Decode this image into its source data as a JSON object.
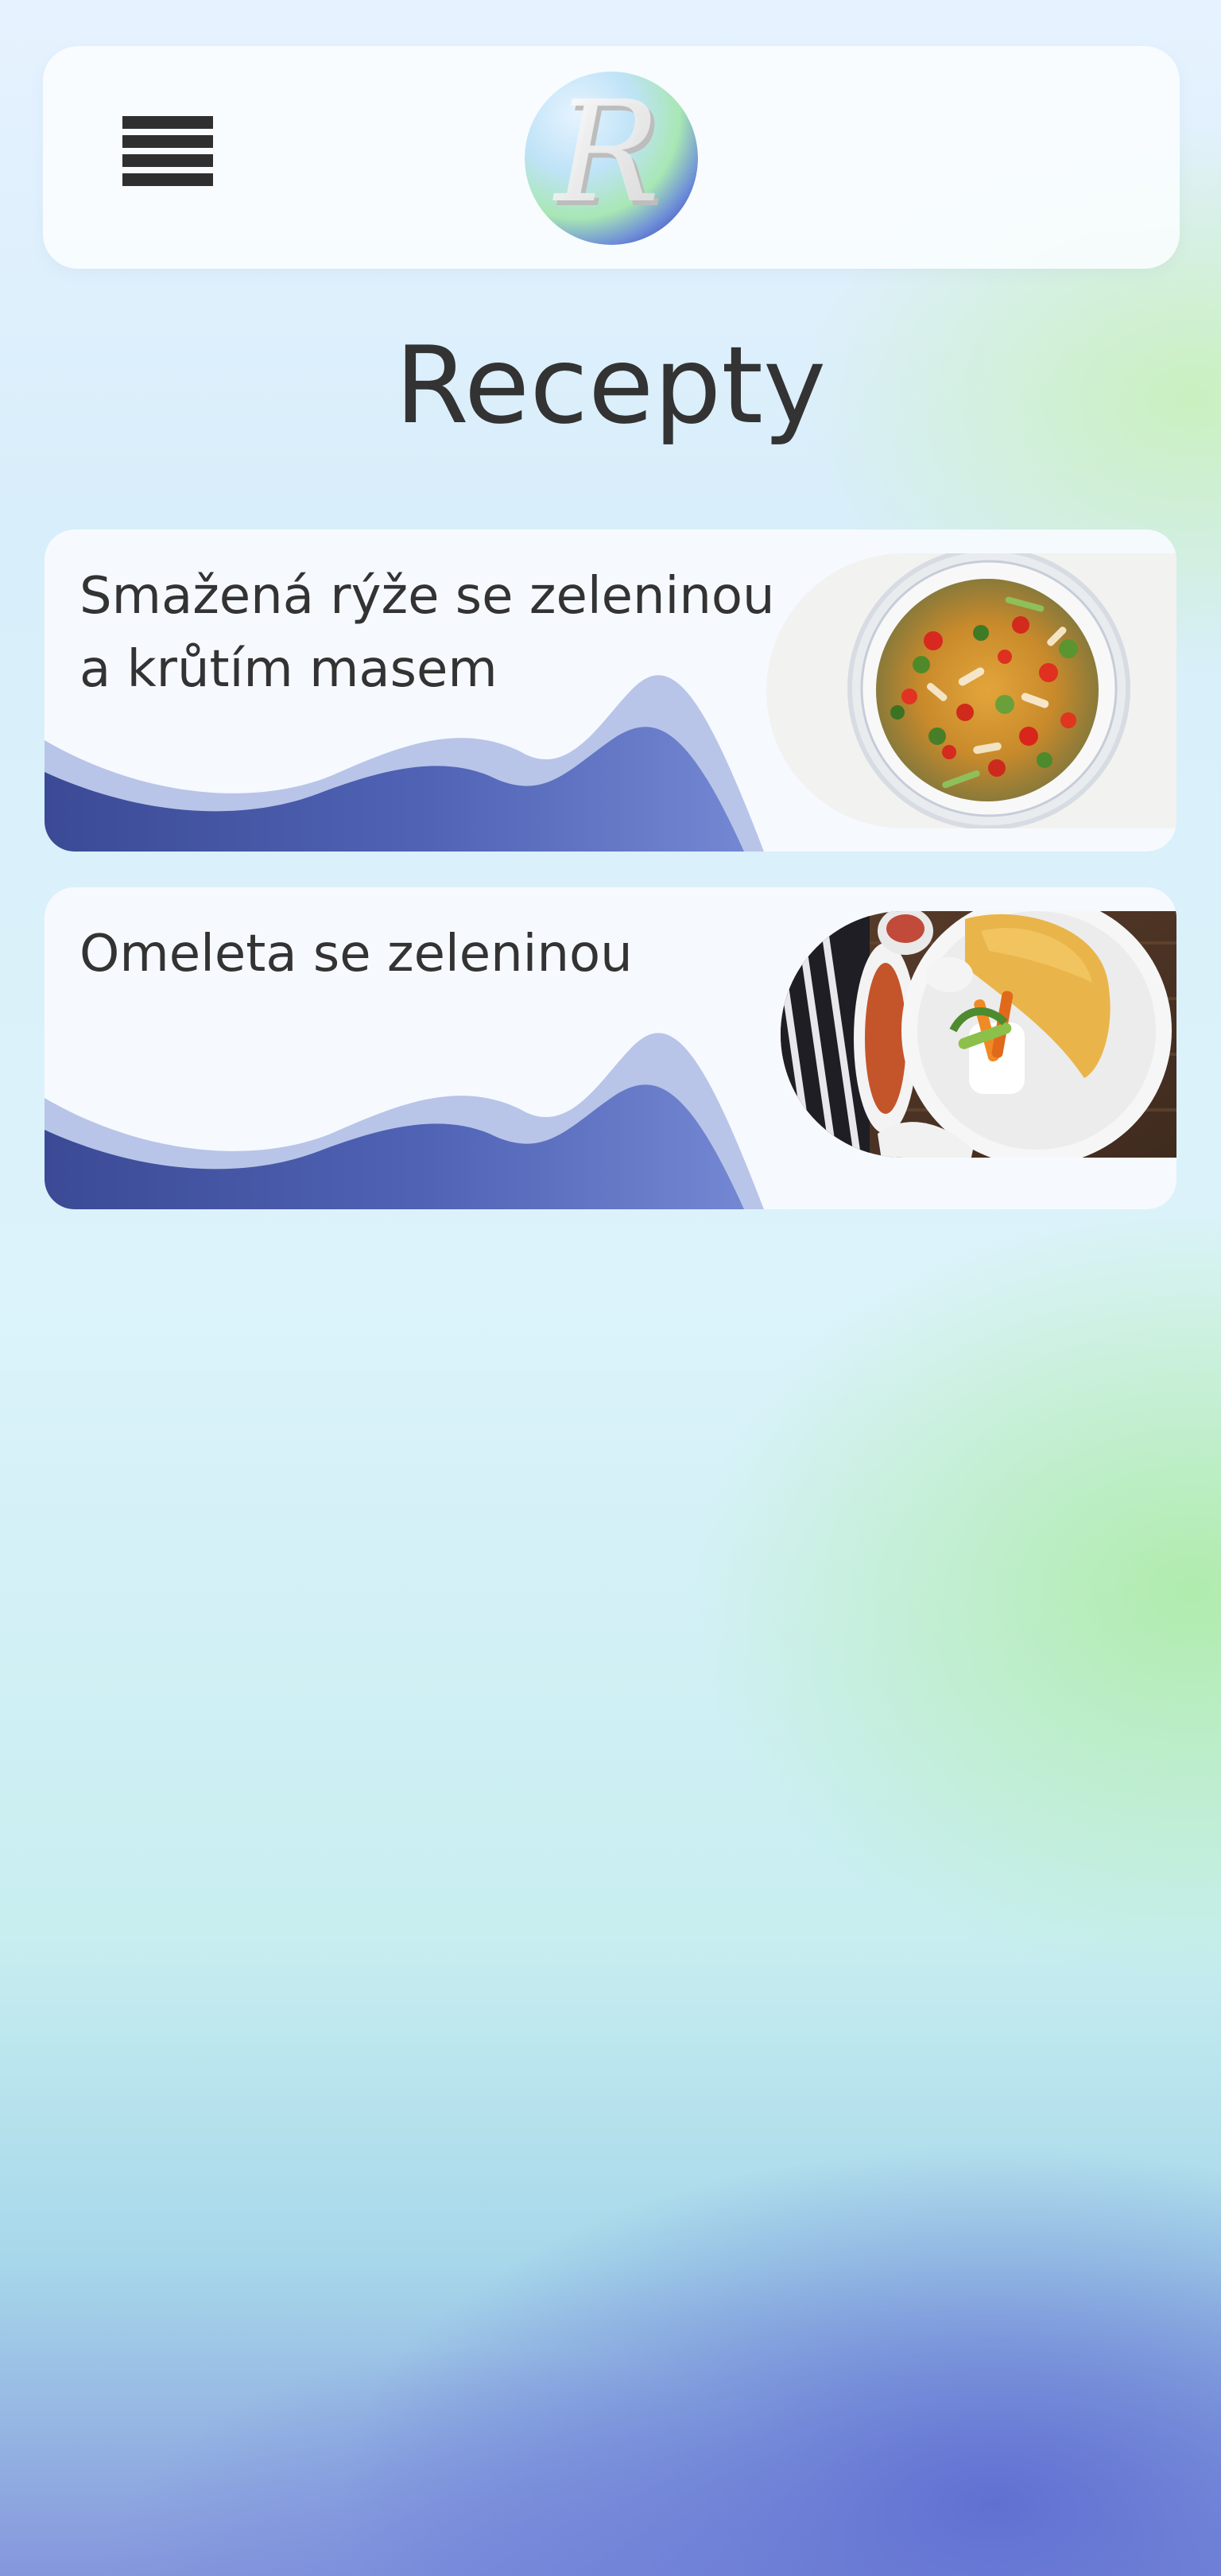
{
  "page": {
    "title": "Recepty"
  },
  "header": {
    "logo_letter": "R"
  },
  "recipes": [
    {
      "title": "Smažená rýže se zeleninou a krůtím masem",
      "photo": "fried-rice-photo"
    },
    {
      "title": "Omeleta se zeleninou",
      "photo": "omelette-photo"
    }
  ],
  "colors": {
    "wave_dark": "#3b4da0",
    "wave_mid": "#6a80cc",
    "wave_light": "#b8c6ea",
    "text": "#333333"
  }
}
